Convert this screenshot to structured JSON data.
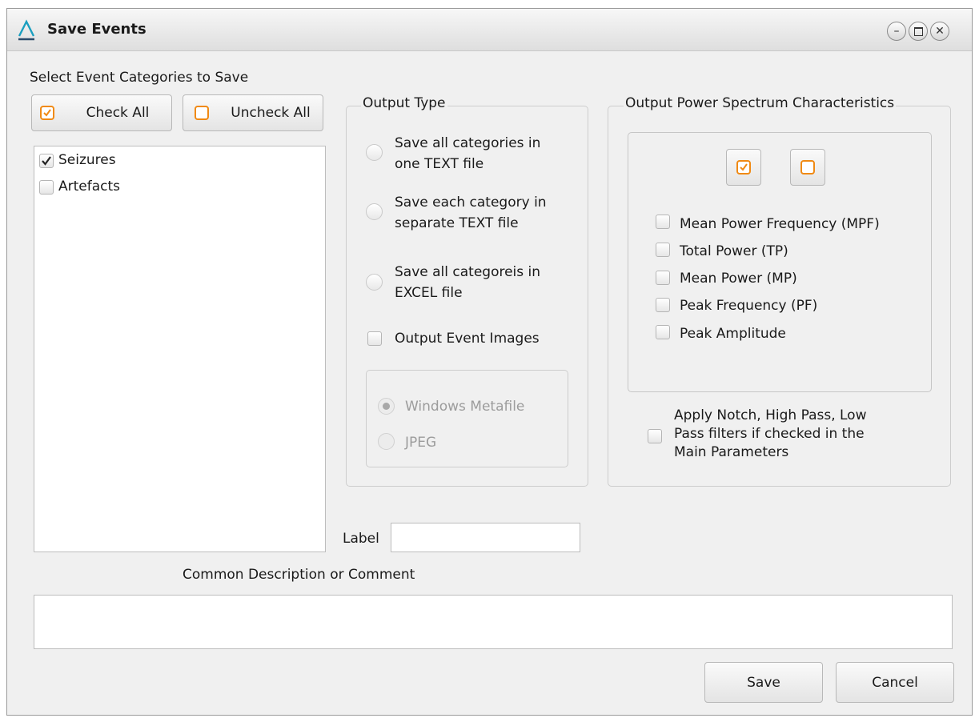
{
  "window": {
    "title": "Save Events"
  },
  "categories": {
    "section_label": "Select Event Categories to Save",
    "check_all_label": "Check All",
    "uncheck_all_label": "Uncheck All",
    "items": [
      {
        "label": "Seizures",
        "checked": true
      },
      {
        "label": "Artefacts",
        "checked": false
      }
    ]
  },
  "output_type": {
    "legend": "Output Type",
    "options": [
      {
        "line1": "Save all categories in",
        "line2": "one TEXT file"
      },
      {
        "line1": "Save each category in",
        "line2": "separate TEXT file"
      },
      {
        "line1": "Save all categoreis in",
        "line2": "EXCEL file"
      }
    ],
    "images_label": "Output Event Images",
    "image_formats": [
      {
        "label": "Windows Metafile",
        "selected": true
      },
      {
        "label": "JPEG",
        "selected": false
      }
    ]
  },
  "spectrum": {
    "legend": "Output Power Spectrum Characteristics",
    "items": [
      "Mean Power Frequency (MPF)",
      "Total Power (TP)",
      "Mean Power (MP)",
      "Peak Frequency (PF)",
      "Peak Amplitude"
    ],
    "filters_line1": "Apply Notch, High Pass, Low",
    "filters_line2": "Pass filters if checked in the",
    "filters_line3": "Main Parameters"
  },
  "label_field": {
    "label": "Label",
    "value": ""
  },
  "comment": {
    "label": "Common Description or Comment",
    "value": ""
  },
  "buttons": {
    "save": "Save",
    "cancel": "Cancel"
  },
  "colors": {
    "accent_orange": "#f08a14",
    "logo_teal": "#1a9fc0"
  }
}
